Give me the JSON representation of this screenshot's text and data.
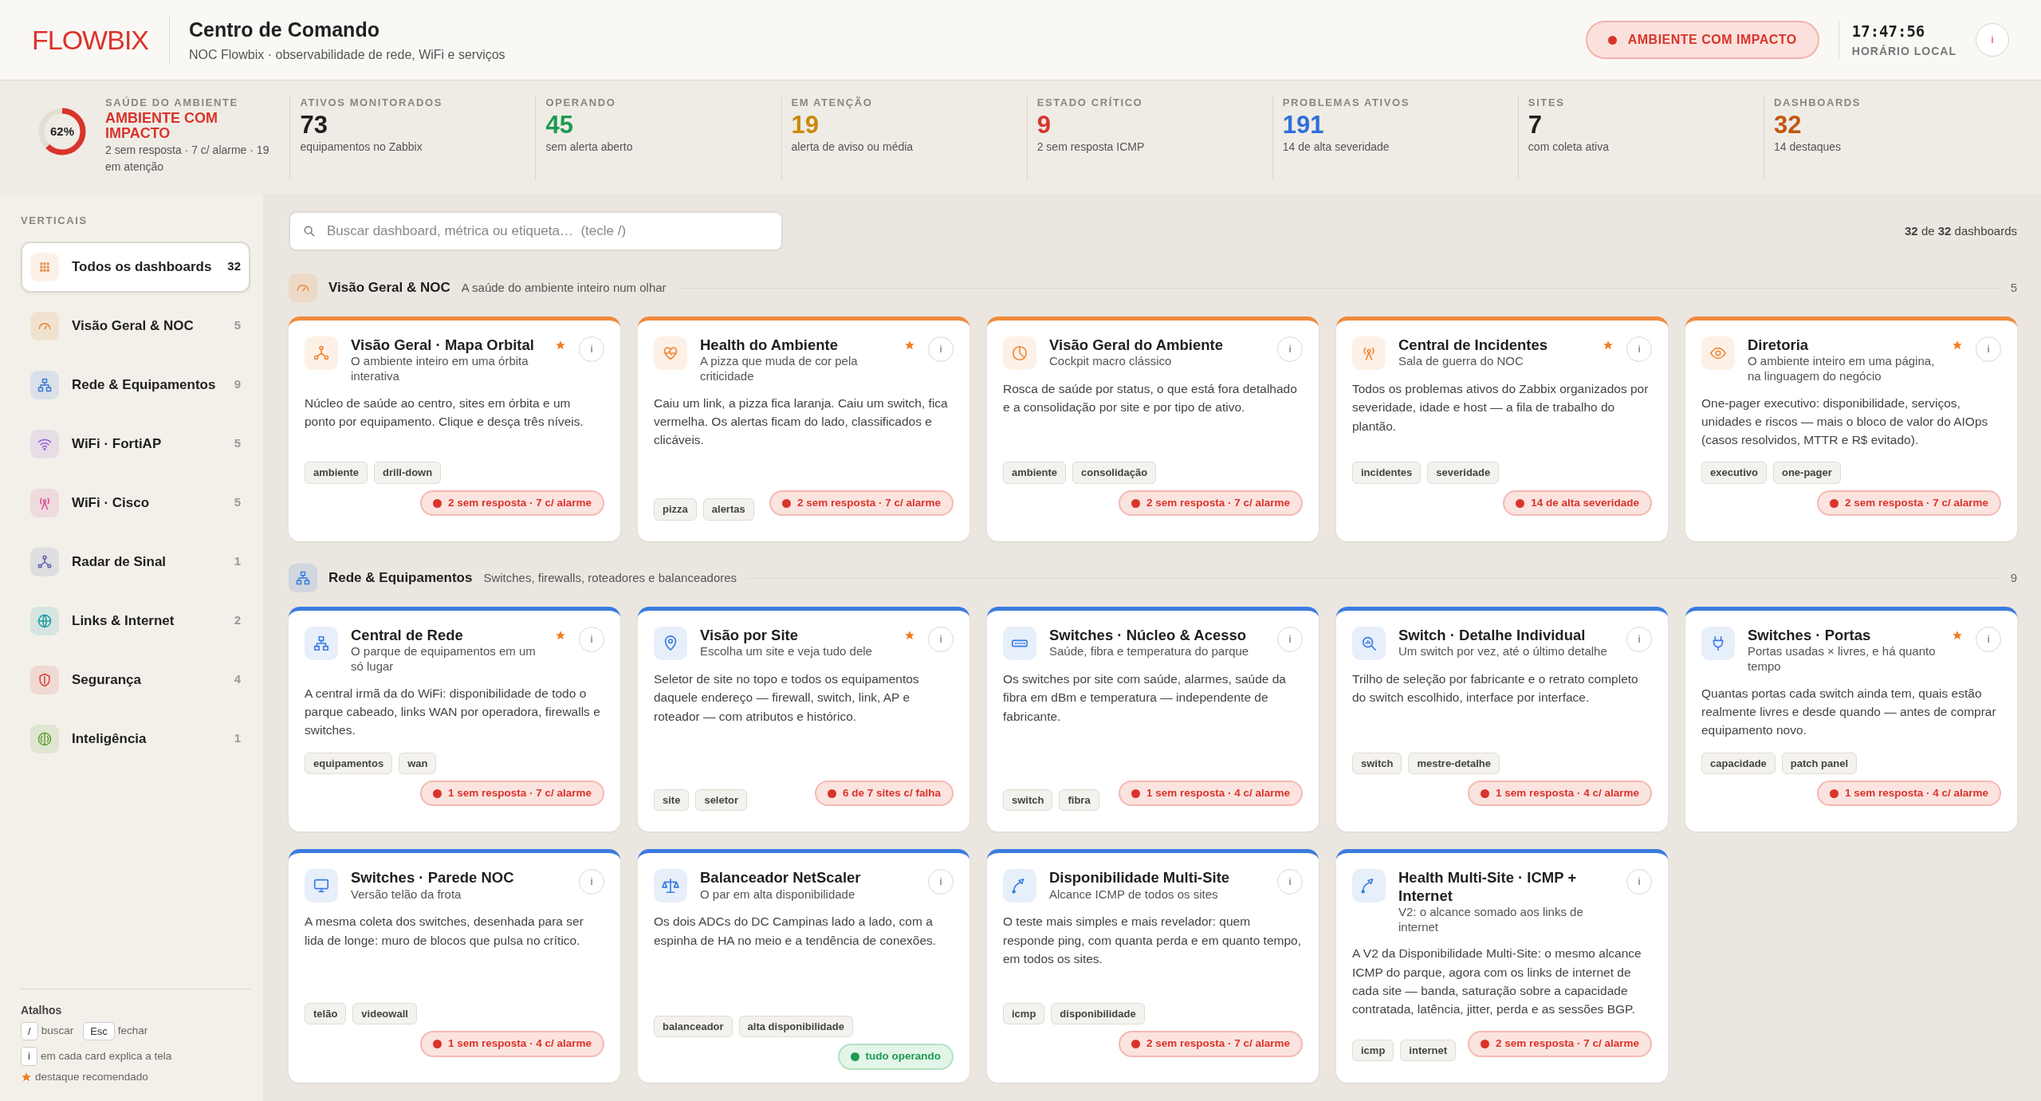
{
  "header": {
    "logo": "FLOWBIX",
    "title": "Centro de Comando",
    "subtitle": "NOC Flowbix · observabilidade de rede, WiFi e serviços",
    "status": "AMBIENTE COM IMPACTO",
    "clock": "17:47:56",
    "clock_label": "HORÁRIO LOCAL",
    "info": "i"
  },
  "health": {
    "label": "SAÚDE DO AMBIENTE",
    "status": "AMBIENTE COM IMPACTO",
    "detail": "2 sem resposta · 7 c/ alarme · 19 em atenção",
    "gauge": "62%",
    "level": 0.62
  },
  "stats": [
    {
      "label": "ATIVOS MONITORADOS",
      "value": "73",
      "detail": "equipamentos no Zabbix",
      "color": "#1f1f1f"
    },
    {
      "label": "OPERANDO",
      "value": "45",
      "detail": "sem alerta aberto",
      "color": "#1f9a52"
    },
    {
      "label": "EM ATENÇÃO",
      "value": "19",
      "detail": "alerta de aviso ou média",
      "color": "#c98a0b"
    },
    {
      "label": "ESTADO CRÍTICO",
      "value": "9",
      "detail": "2 sem resposta ICMP",
      "color": "#d9342b"
    },
    {
      "label": "PROBLEMAS ATIVOS",
      "value": "191",
      "detail": "14 de alta severidade",
      "color": "#2f6fdb"
    },
    {
      "label": "SITES",
      "value": "7",
      "detail": "com coleta ativa",
      "color": "#1f1f1f"
    },
    {
      "label": "DASHBOARDS",
      "value": "32",
      "detail": "14 destaques",
      "color": "#c0570f"
    }
  ],
  "sidebar": {
    "heading": "VERTICAIS",
    "items": [
      {
        "label": "Todos os dashboards",
        "count": "32",
        "selected": true,
        "color": "#e8945a"
      },
      {
        "label": "Visão Geral & NOC",
        "count": "5",
        "selected": false,
        "color": "#e8842f"
      },
      {
        "label": "Rede & Equipamentos",
        "count": "9",
        "selected": false,
        "color": "#3b78d8"
      },
      {
        "label": "WiFi · FortiAP",
        "count": "5",
        "selected": false,
        "color": "#9a5fd6"
      },
      {
        "label": "WiFi · Cisco",
        "count": "5",
        "selected": false,
        "color": "#d64a97"
      },
      {
        "label": "Radar de Sinal",
        "count": "1",
        "selected": false,
        "color": "#5b5fa8"
      },
      {
        "label": "Links & Internet",
        "count": "2",
        "selected": false,
        "color": "#1c9aa3"
      },
      {
        "label": "Segurança",
        "count": "4",
        "selected": false,
        "color": "#d9433a"
      },
      {
        "label": "Inteligência",
        "count": "1",
        "selected": false,
        "color": "#5f9e2f"
      }
    ],
    "shortcuts_title": "Atalhos",
    "shortcuts": [
      {
        "keys": [
          "/"
        ],
        "text": "buscar"
      },
      {
        "keys": [
          "Esc"
        ],
        "text": "fechar"
      },
      {
        "keys": [
          "i"
        ],
        "text": "em cada card explica a tela"
      }
    ],
    "legend": "destaque recomendado"
  },
  "search": {
    "placeholder": "Buscar dashboard, métrica ou etiqueta…  (tecle /)"
  },
  "result_count": "**32** de **32** dashboards",
  "sections": [
    {
      "title": "Visão Geral & NOC",
      "subtitle": "A saúde do ambiente inteiro num olhar",
      "count": "5",
      "color": "#f08a3c",
      "cards": [
        {
          "title": "Visão Geral · Mapa Orbital",
          "subtitle": "O ambiente inteiro em uma órbita interativa",
          "description": "Núcleo de saúde ao centro, sites em órbita e um ponto por equipamento. Clique e desça três níveis.",
          "featured": true,
          "info": "i",
          "tags": [
            "ambiente",
            "drill-down"
          ],
          "status": {
            "kind": "alert",
            "text": "2 sem resposta · 7 c/ alarme"
          }
        },
        {
          "title": "Health do Ambiente",
          "subtitle": "A pizza que muda de cor pela criticidade",
          "description": "Caiu um link, a pizza fica laranja. Caiu um switch, fica vermelha. Os alertas ficam do lado, classificados e clicáveis.",
          "featured": true,
          "info": "i",
          "tags": [
            "pizza",
            "alertas"
          ],
          "status": {
            "kind": "alert",
            "text": "2 sem resposta · 7 c/ alarme"
          }
        },
        {
          "title": "Visão Geral do Ambiente",
          "subtitle": "Cockpit macro clássico",
          "description": "Rosca de saúde por status, o que está fora detalhado e a consolidação por site e por tipo de ativo.",
          "featured": false,
          "info": "i",
          "tags": [
            "ambiente",
            "consolidação"
          ],
          "status": {
            "kind": "alert",
            "text": "2 sem resposta · 7 c/ alarme"
          }
        },
        {
          "title": "Central de Incidentes",
          "subtitle": "Sala de guerra do NOC",
          "description": "Todos os problemas ativos do Zabbix organizados por severidade, idade e host — a fila de trabalho do plantão.",
          "featured": true,
          "info": "i",
          "tags": [
            "incidentes",
            "severidade"
          ],
          "status": {
            "kind": "alert",
            "text": "14 de alta severidade"
          }
        },
        {
          "title": "Diretoria",
          "subtitle": "O ambiente inteiro em uma página, na linguagem do negócio",
          "description": "One-pager executivo: disponibilidade, serviços, unidades e riscos — mais o bloco de valor do AIOps (casos resolvidos, MTTR e R$ evitado).",
          "featured": true,
          "info": "i",
          "tags": [
            "executivo",
            "one-pager"
          ],
          "status": {
            "kind": "alert",
            "text": "2 sem resposta · 7 c/ alarme"
          }
        }
      ]
    },
    {
      "title": "Rede & Equipamentos",
      "subtitle": "Switches, firewalls, roteadores e balanceadores",
      "count": "9",
      "color": "#3b7be0",
      "cards": [
        {
          "title": "Central de Rede",
          "subtitle": "O parque de equipamentos em um só lugar",
          "description": "A central irmã da do WiFi: disponibilidade de todo o parque cabeado, links WAN por operadora, firewalls e switches.",
          "featured": true,
          "info": "i",
          "tags": [
            "equipamentos",
            "wan"
          ],
          "status": {
            "kind": "alert",
            "text": "1 sem resposta · 7 c/ alarme"
          }
        },
        {
          "title": "Visão por Site",
          "subtitle": "Escolha um site e veja tudo dele",
          "description": "Seletor de site no topo e todos os equipamentos daquele endereço — firewall, switch, link, AP e roteador — com atributos e histórico.",
          "featured": true,
          "info": "i",
          "tags": [
            "site",
            "seletor"
          ],
          "status": {
            "kind": "alert",
            "text": "6 de 7 sites c/ falha"
          }
        },
        {
          "title": "Switches · Núcleo & Acesso",
          "subtitle": "Saúde, fibra e temperatura do parque",
          "description": "Os switches por site com saúde, alarmes, saúde da fibra em dBm e temperatura — independente de fabricante.",
          "featured": false,
          "info": "i",
          "tags": [
            "switch",
            "fibra"
          ],
          "status": {
            "kind": "alert",
            "text": "1 sem resposta · 4 c/ alarme"
          }
        },
        {
          "title": "Switch · Detalhe Individual",
          "subtitle": "Um switch por vez, até o último detalhe",
          "description": "Trilho de seleção por fabricante e o retrato completo do switch escolhido, interface por interface.",
          "featured": false,
          "info": "i",
          "tags": [
            "switch",
            "mestre-detalhe"
          ],
          "status": {
            "kind": "alert",
            "text": "1 sem resposta · 4 c/ alarme"
          }
        },
        {
          "title": "Switches · Portas",
          "subtitle": "Portas usadas × livres, e há quanto tempo",
          "description": "Quantas portas cada switch ainda tem, quais estão realmente livres e desde quando — antes de comprar equipamento novo.",
          "featured": true,
          "info": "i",
          "tags": [
            "capacidade",
            "patch panel"
          ],
          "status": {
            "kind": "alert",
            "text": "1 sem resposta · 4 c/ alarme"
          }
        },
        {
          "title": "Switches · Parede NOC",
          "subtitle": "Versão telão da frota",
          "description": "A mesma coleta dos switches, desenhada para ser lida de longe: muro de blocos que pulsa no crítico.",
          "featured": false,
          "info": "i",
          "tags": [
            "telão",
            "videowall"
          ],
          "status": {
            "kind": "alert",
            "text": "1 sem resposta · 4 c/ alarme"
          }
        },
        {
          "title": "Balanceador NetScaler",
          "subtitle": "O par em alta disponibilidade",
          "description": "Os dois ADCs do DC Campinas lado a lado, com a espinha de HA no meio e a tendência de conexões.",
          "featured": false,
          "info": "i",
          "tags": [
            "balanceador",
            "alta disponibilidade"
          ],
          "status": {
            "kind": "ok",
            "text": "tudo operando"
          }
        },
        {
          "title": "Disponibilidade Multi-Site",
          "subtitle": "Alcance ICMP de todos os sites",
          "description": "O teste mais simples e mais revelador: quem responde ping, com quanta perda e em quanto tempo, em todos os sites.",
          "featured": false,
          "info": "i",
          "tags": [
            "icmp",
            "disponibilidade"
          ],
          "status": {
            "kind": "alert",
            "text": "2 sem resposta · 7 c/ alarme"
          }
        },
        {
          "title": "Health Multi-Site · ICMP + Internet",
          "subtitle": "V2: o alcance somado aos links de internet",
          "description": "A V2 da Disponibilidade Multi-Site: o mesmo alcance ICMP do parque, agora com os links de internet de cada site — banda, saturação sobre a capacidade contratada, latência, jitter, perda e as sessões BGP.",
          "featured": false,
          "info": "i",
          "tags": [
            "icmp",
            "internet"
          ],
          "status": {
            "kind": "alert",
            "text": "2 sem resposta · 7 c/ alarme"
          }
        }
      ]
    }
  ]
}
